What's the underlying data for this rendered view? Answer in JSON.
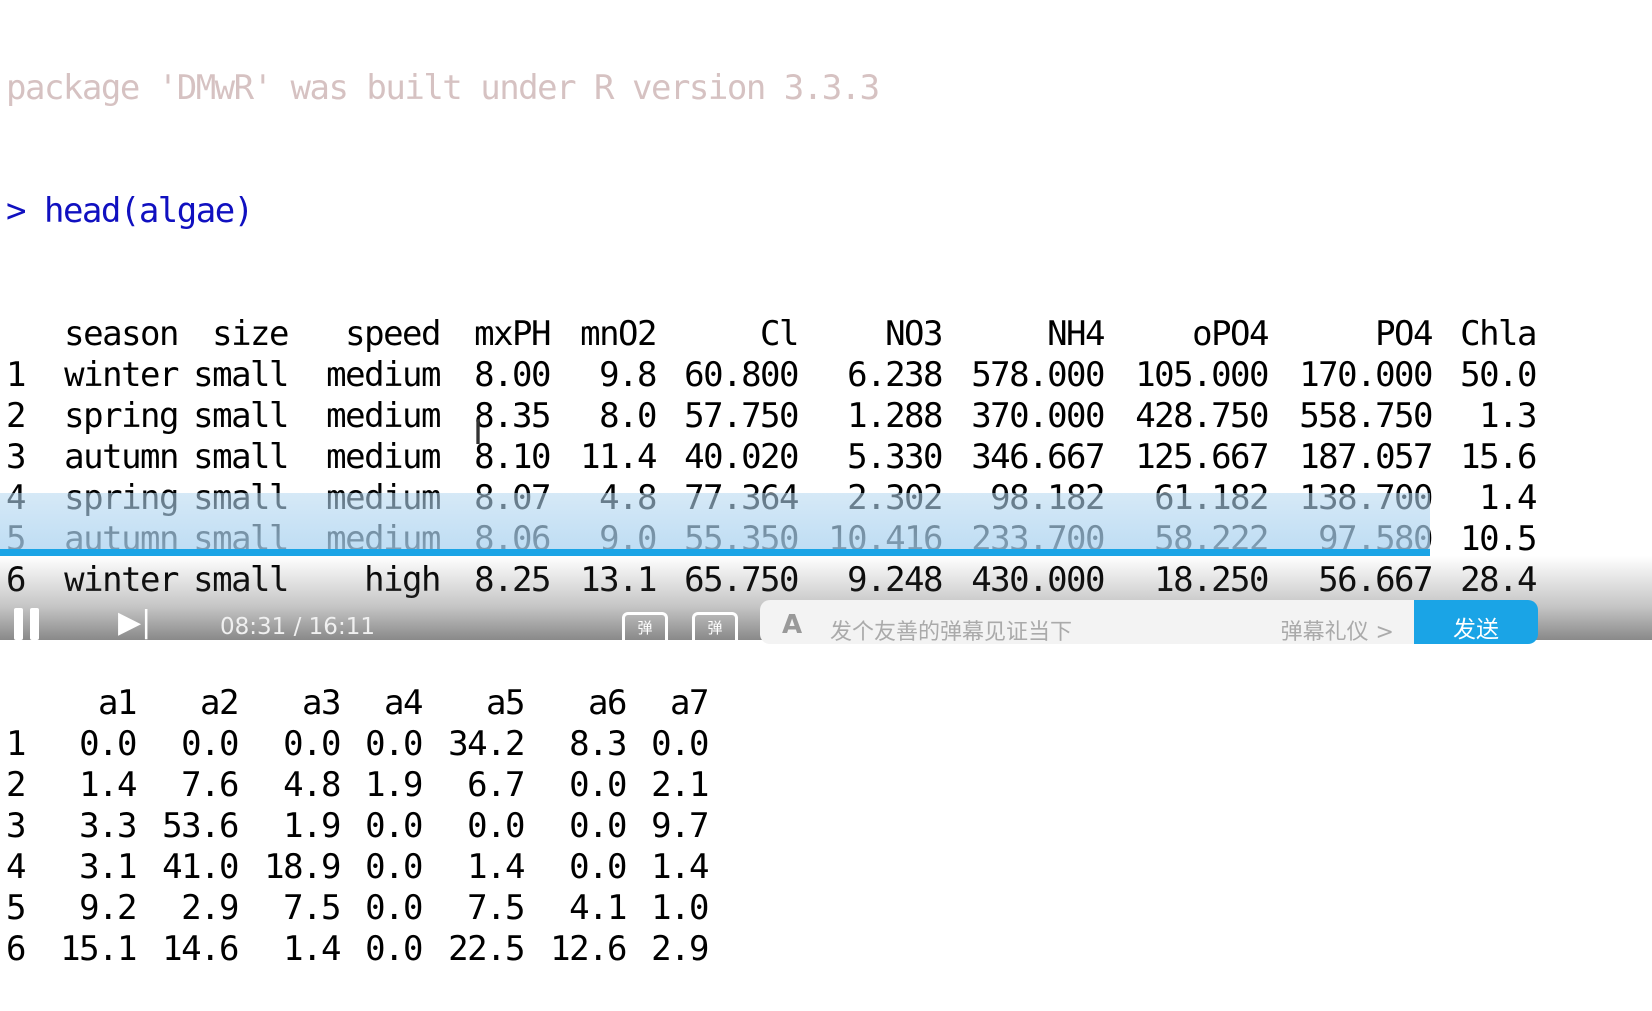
{
  "console": {
    "faded_line": "package 'DMwR' was built under R version 3.3.3",
    "prompt": ">",
    "command": "head(algae)",
    "table1": {
      "headers": [
        "season",
        "size",
        "speed",
        "mxPH",
        "mnO2",
        "Cl",
        "NO3",
        "NH4",
        "oPO4",
        "PO4",
        "Chla"
      ],
      "rows": [
        [
          "1",
          "winter",
          "small",
          "medium",
          "8.00",
          "9.8",
          "60.800",
          "6.238",
          "578.000",
          "105.000",
          "170.000",
          "50.0"
        ],
        [
          "2",
          "spring",
          "small",
          "medium",
          "8.35",
          "8.0",
          "57.750",
          "1.288",
          "370.000",
          "428.750",
          "558.750",
          "1.3"
        ],
        [
          "3",
          "autumn",
          "small",
          "medium",
          "8.10",
          "11.4",
          "40.020",
          "5.330",
          "346.667",
          "125.667",
          "187.057",
          "15.6"
        ],
        [
          "4",
          "spring",
          "small",
          "medium",
          "8.07",
          "4.8",
          "77.364",
          "2.302",
          "98.182",
          "61.182",
          "138.700",
          "1.4"
        ],
        [
          "5",
          "autumn",
          "small",
          "medium",
          "8.06",
          "9.0",
          "55.350",
          "10.416",
          "233.700",
          "58.222",
          "97.580",
          "10.5"
        ],
        [
          "6",
          "winter",
          "small",
          "high",
          "8.25",
          "13.1",
          "65.750",
          "9.248",
          "430.000",
          "18.250",
          "56.667",
          "28.4"
        ]
      ]
    },
    "table2": {
      "headers": [
        "a1",
        "a2",
        "a3",
        "a4",
        "a5",
        "a6",
        "a7"
      ],
      "rows": [
        [
          "1",
          "0.0",
          "0.0",
          "0.0",
          "0.0",
          "34.2",
          "8.3",
          "0.0"
        ],
        [
          "2",
          "1.4",
          "7.6",
          "4.8",
          "1.9",
          "6.7",
          "0.0",
          "2.1"
        ],
        [
          "3",
          "3.3",
          "53.6",
          "1.9",
          "0.0",
          "0.0",
          "0.0",
          "9.7"
        ],
        [
          "4",
          "3.1",
          "41.0",
          "18.9",
          "0.0",
          "1.4",
          "0.0",
          "1.4"
        ],
        [
          "5",
          "9.2",
          "2.9",
          "7.5",
          "0.0",
          "7.5",
          "4.1",
          "1.0"
        ],
        [
          "6",
          "15.1",
          "14.6",
          "1.4",
          "0.0",
          "22.5",
          "12.6",
          "2.9"
        ]
      ]
    }
  },
  "player": {
    "current_time": "08:31",
    "separator": "/",
    "total_time": "16:11",
    "danmu_icon_label": "弹",
    "danmu_placeholder": "发个友善的弹幕见证当下",
    "danmu_etiquette": "弹幕礼仪 >",
    "send_label": "发送",
    "progress": 0.526,
    "accent_color": "#1aa4e6"
  }
}
